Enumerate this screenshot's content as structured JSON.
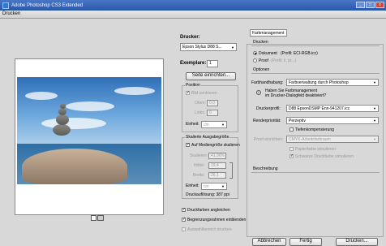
{
  "window": {
    "title": "Adobe Photoshop CS3 Extended",
    "min": "_",
    "max": "□",
    "close": "x"
  },
  "dialog": {
    "title": "Drucken"
  },
  "printer": {
    "label": "Drucker:",
    "value": "Epson Stylus D88 S...",
    "copies_label": "Exemplare:",
    "copies_value": "1",
    "page_setup": "Seite einrichten..."
  },
  "position": {
    "group": "Position",
    "center_label": "Bild zentrieren",
    "top_label": "Oben:",
    "top_value": "0,0",
    "left_label": "Links:",
    "left_value": "0",
    "unit_label": "Einheit:",
    "unit_value": "cm"
  },
  "scaled": {
    "group": "Skalierte Ausgabegröße",
    "fit_label": "Auf Mediengröße skalieren",
    "scale_label": "Skalieren:",
    "scale_value": "41,96%",
    "height_label": "Höhe:",
    "height_value": "19,4",
    "width_label": "Breite:",
    "width_value": "26,1",
    "unit_label": "Einheit:",
    "unit_value": "cm",
    "resolution": "Druckauflösung: 387 ppi"
  },
  "options": {
    "match_colors": "Druckfarben angleichen",
    "bounding_box": "Begrenzungsrahmen einblenden",
    "print_selection": "Auswahlbereich drucken"
  },
  "right": {
    "mode_value": "Farbmanagement",
    "print_heading": "Drucken",
    "doc_label": "Dokument",
    "doc_profile": "(Profil: ECI-RGB.icc)",
    "proof_label": "Proof",
    "proof_profile": "(Profil: k. pr...)",
    "options_heading": "Optionen",
    "color_handling_label": "Farbhandhabung:",
    "color_handling_value": "Farbverwaltung durch Photoshop",
    "info_text_1": "Haben Sie Farbmanagement",
    "info_text_2": "im Drucker-Dialogfeld deaktiviert?",
    "printer_profile_label": "Druckerprofil:",
    "printer_profile_value": "D88 EpsonDSMP Enn-941207.icc",
    "render_label": "Renderpriorität:",
    "render_value": "Perzeptiv",
    "depth_comp": "Tiefenkompensierung",
    "proof_setup_label": "Proof einrichten:",
    "proof_setup_value": "CMYK-Arbeitsfarbraum",
    "paper_color": "Papierfarbe simulieren",
    "black_ink": "Schwarze Druckfarbe simulieren",
    "description_heading": "Beschreibung"
  },
  "buttons": {
    "cancel": "Abbrechen",
    "done": "Fertig",
    "print": "Drucken..."
  }
}
